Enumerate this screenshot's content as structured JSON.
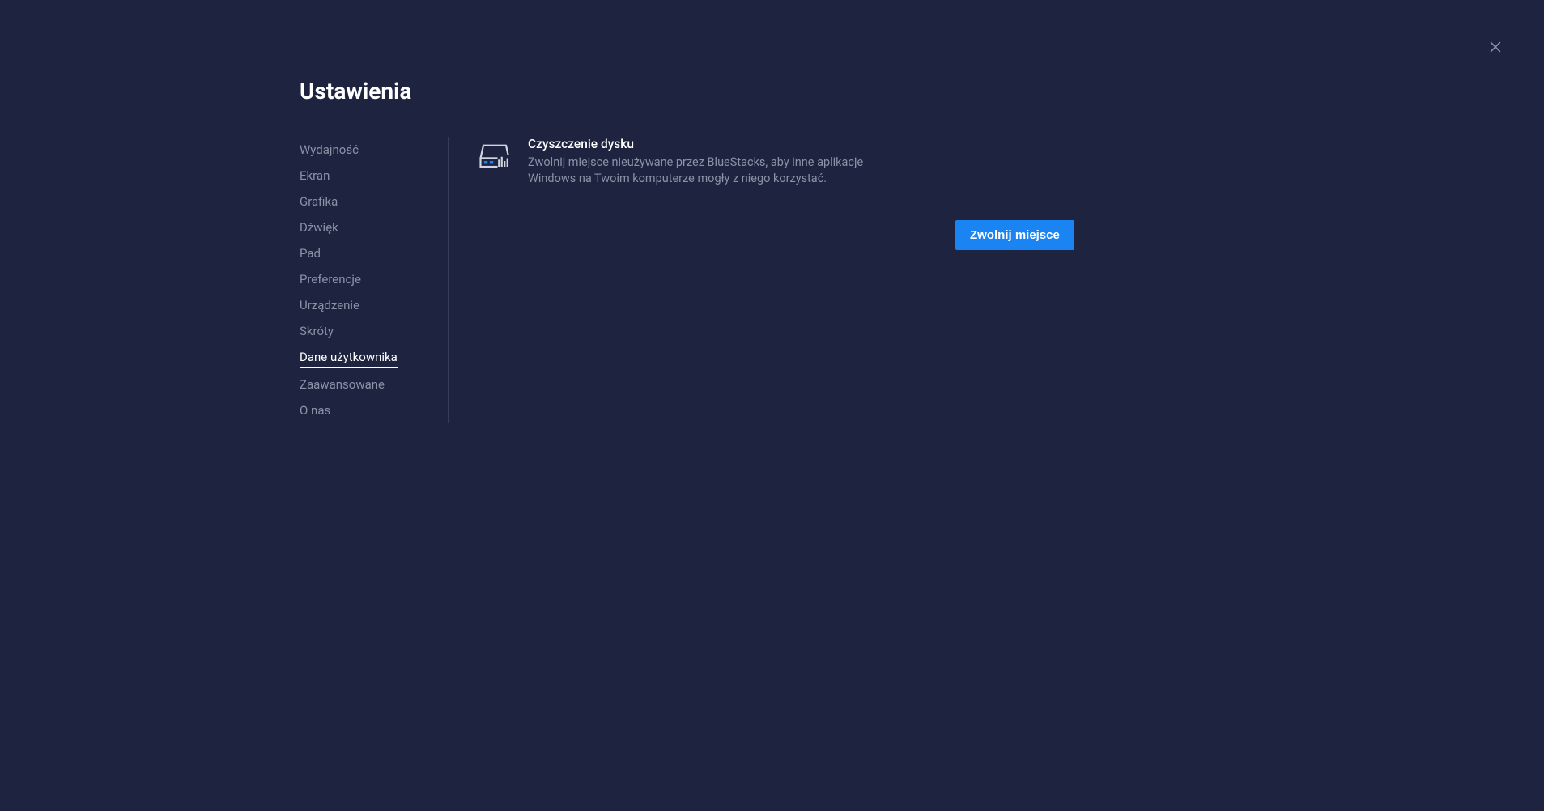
{
  "page_title": "Ustawienia",
  "sidebar": {
    "items": [
      {
        "label": "Wydajność",
        "active": false
      },
      {
        "label": "Ekran",
        "active": false
      },
      {
        "label": "Grafika",
        "active": false
      },
      {
        "label": "Dźwięk",
        "active": false
      },
      {
        "label": "Pad",
        "active": false
      },
      {
        "label": "Preferencje",
        "active": false
      },
      {
        "label": "Urządzenie",
        "active": false
      },
      {
        "label": "Skróty",
        "active": false
      },
      {
        "label": "Dane użytkownika",
        "active": true
      },
      {
        "label": "Zaawansowane",
        "active": false
      },
      {
        "label": "O nas",
        "active": false
      }
    ]
  },
  "main": {
    "disk_cleanup": {
      "title": "Czyszczenie dysku",
      "description": "Zwolnij miejsce nieużywane przez BlueStacks, aby inne aplikacje Windows na Twoim komputerze mogły z niego korzystać.",
      "button_label": "Zwolnij miejsce"
    }
  }
}
